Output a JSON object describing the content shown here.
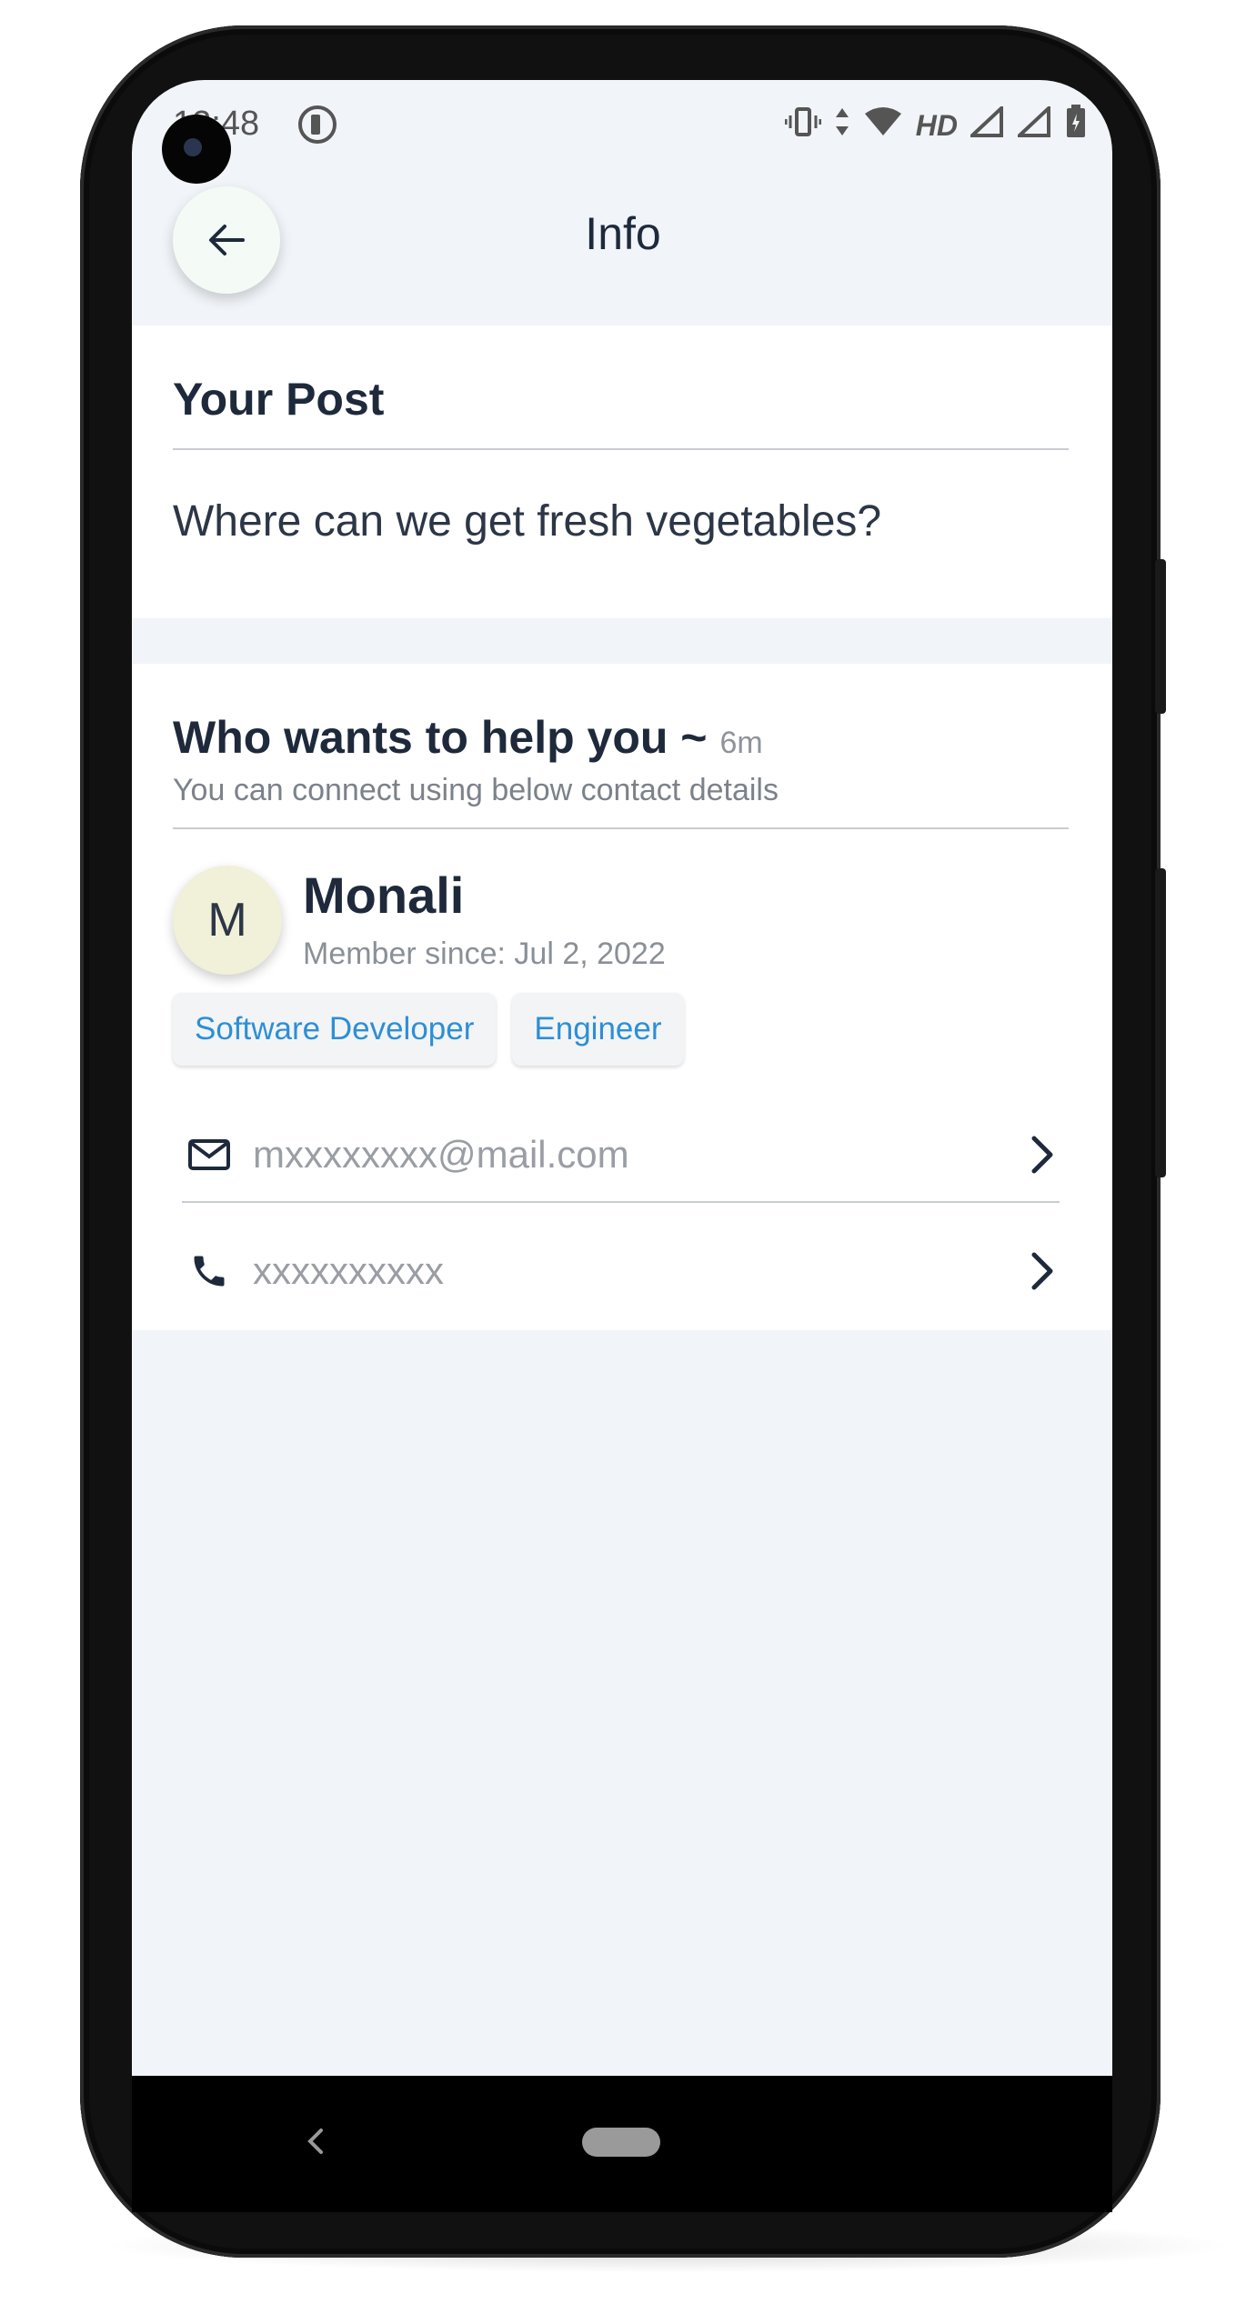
{
  "status_bar": {
    "time": "12:48",
    "network_label": "HD"
  },
  "header": {
    "title": "Info"
  },
  "post": {
    "section_title": "Your Post",
    "text": "Where can we get fresh vegetables?"
  },
  "helper": {
    "section_title": "Who wants to help you ~",
    "time_ago": "6m",
    "subtitle": "You can connect using below contact details",
    "avatar_initial": "M",
    "name": "Monali",
    "member_since": "Member since: Jul 2, 2022",
    "tags": [
      "Software Developer",
      "Engineer"
    ],
    "email": "mxxxxxxxx@mail.com",
    "phone": "xxxxxxxxxx"
  },
  "colors": {
    "screen_bg": "#f1f4f8",
    "card_bg": "#ffffff",
    "text_dark": "#1e2a3b",
    "tag_text": "#2d8fd6",
    "avatar_bg": "#f1f0d8"
  }
}
